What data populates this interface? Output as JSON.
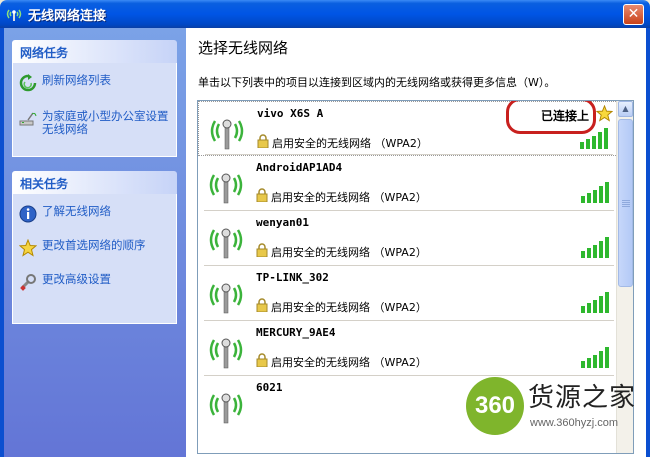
{
  "window": {
    "title": "无线网络连接",
    "close_glyph": "✕"
  },
  "taskpane": {
    "network_tasks": {
      "header": "网络任务",
      "items": [
        {
          "label": "刷新网络列表",
          "icon": "refresh-icon"
        },
        {
          "label": "为家庭或小型办公室设置无线网络",
          "icon": "wireless-setup-icon"
        }
      ]
    },
    "related_tasks": {
      "header": "相关任务",
      "items": [
        {
          "label": "了解无线网络",
          "icon": "info-icon"
        },
        {
          "label": "更改首选网络的顺序",
          "icon": "star-icon"
        },
        {
          "label": "更改高级设置",
          "icon": "settings-icon"
        }
      ]
    }
  },
  "main": {
    "heading": "选择无线网络",
    "description": "单击以下列表中的项目以连接到区域内的无线网络或获得更多信息（W）。",
    "networks": [
      {
        "name": "vivo X6S A",
        "security": "启用安全的无线网络 （WPA2）",
        "status": "已连接上",
        "signal_bars": 5,
        "preferred": true
      },
      {
        "name": "AndroidAP1AD4",
        "security": "启用安全的无线网络 （WPA2）",
        "status": "",
        "signal_bars": 5,
        "preferred": false
      },
      {
        "name": "wenyan01",
        "security": "启用安全的无线网络 （WPA2）",
        "status": "",
        "signal_bars": 5,
        "preferred": false
      },
      {
        "name": "TP-LINK_302",
        "security": "启用安全的无线网络 （WPA2）",
        "status": "",
        "signal_bars": 5,
        "preferred": false
      },
      {
        "name": "MERCURY_9AE4",
        "security": "启用安全的无线网络 （WPA2）",
        "status": "",
        "signal_bars": 5,
        "preferred": false
      },
      {
        "name": "6021",
        "security": "",
        "status": "",
        "signal_bars": 5,
        "preferred": false
      }
    ]
  },
  "watermark": {
    "logo_number": "360",
    "brand": "货源之家",
    "url": "www.360hyzj.com"
  },
  "colors": {
    "titlebar": "#0055e5",
    "taskpane": "#6f8ee0",
    "link": "#215dc6",
    "signal_green": "#2eb82e",
    "highlight": "#c8201e"
  }
}
